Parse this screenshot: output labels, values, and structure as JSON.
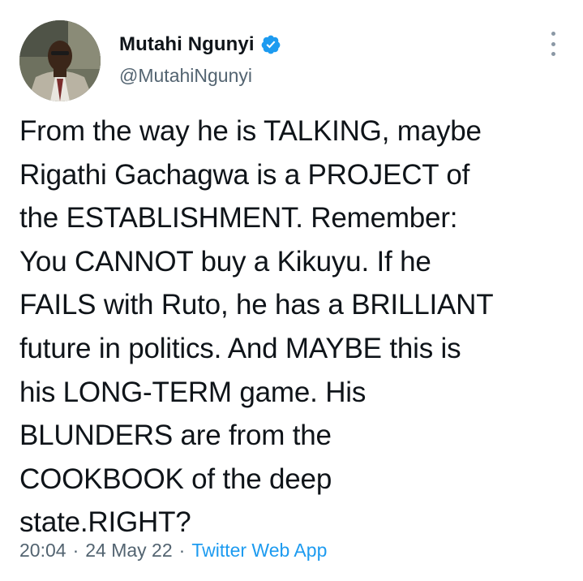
{
  "author": {
    "display_name": "Mutahi Ngunyi",
    "handle": "@MutahiNgunyi",
    "verified": true
  },
  "tweet": {
    "text": "From the way he is TALKING, maybe\nRigathi Gachagwa is a PROJECT of\nthe ESTABLISHMENT. Remember:\nYou CANNOT buy a Kikuyu. If he\nFAILS with Ruto, he has a BRILLIANT\nfuture in politics. And MAYBE this is\nhis LONG-TERM game. His\nBLUNDERS are from the\nCOOKBOOK of the deep\nstate.RIGHT?"
  },
  "meta": {
    "time": "20:04",
    "separator": "·",
    "date": "24 May 22",
    "source": "Twitter Web App"
  },
  "icons": {
    "verified": "verified-badge-icon",
    "more": "more-vertical-icon"
  },
  "colors": {
    "accent": "#1d9bf0",
    "text": "#0f1419",
    "secondary": "#536471"
  }
}
